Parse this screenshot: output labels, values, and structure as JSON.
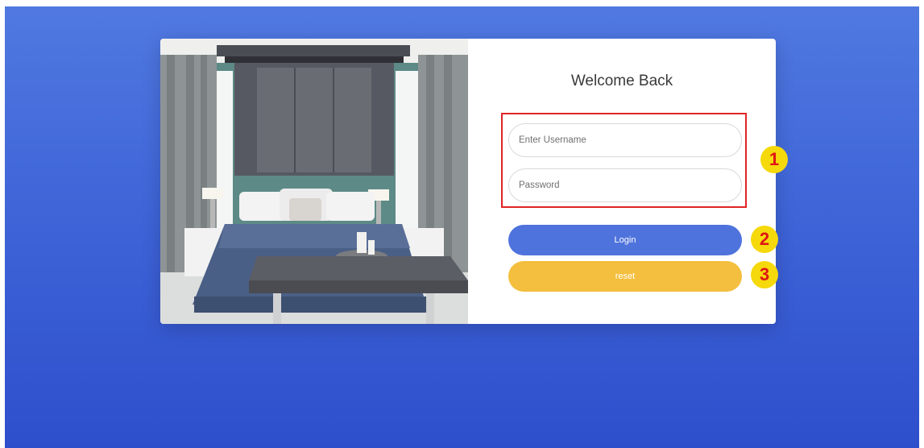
{
  "login": {
    "heading": "Welcome Back",
    "username_placeholder": "Enter Username",
    "password_placeholder": "Password",
    "login_label": "Login",
    "reset_label": "reset"
  },
  "annotations": {
    "badge_1": "1",
    "badge_2": "2",
    "badge_3": "3"
  },
  "colors": {
    "background": "#4068d8",
    "login_button": "#4f73dc",
    "reset_button": "#f4bf3e",
    "highlight_box": "#e02424",
    "badge": "#f5d90b"
  }
}
